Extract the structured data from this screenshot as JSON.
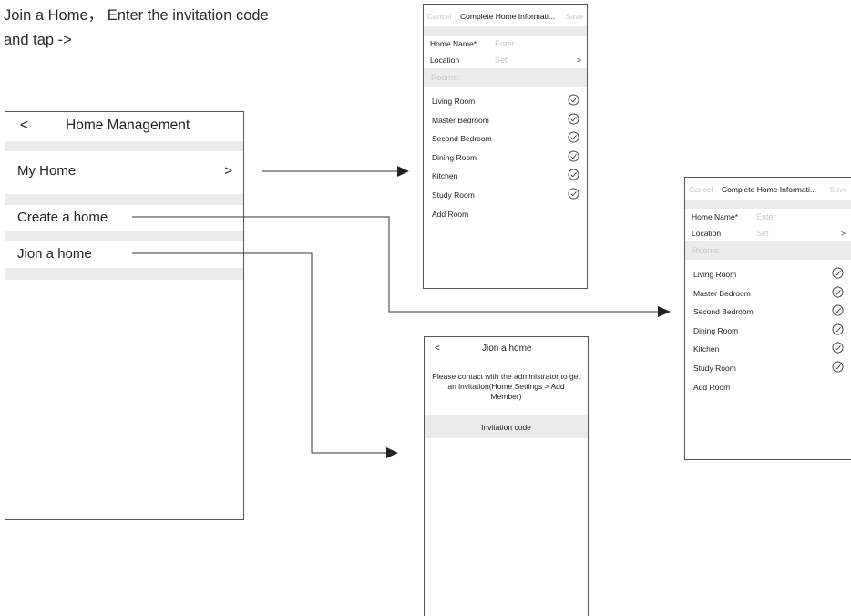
{
  "intro": {
    "text": "Join a Home， Enter the invitation code\nand tap ->"
  },
  "home_management": {
    "back": "<",
    "title": "Home Management",
    "my_home": "My Home",
    "my_home_chevron": ">",
    "create_home": "Create a home",
    "join_home": "Jion a home"
  },
  "complete_home": {
    "cancel": "Cancel",
    "title": "Complete Home Informati...",
    "save": "Save",
    "home_name_label": "Home Name*",
    "home_name_placeholder": "Enter",
    "location_label": "Location",
    "location_value": "Set",
    "location_chevron": ">",
    "rooms_header": "Rooms:",
    "rooms": [
      "Living Room",
      "Master Bedroom",
      "Second Bedroom",
      "Dining Room",
      "Kitchen",
      "Study Room"
    ],
    "add_room": "Add Room"
  },
  "join_home": {
    "back": "<",
    "title": "Jion a home",
    "message": "Please contact with the administrator to get an invitation(Home Settings > Add Member)",
    "invitation_code": "Invitation code"
  }
}
